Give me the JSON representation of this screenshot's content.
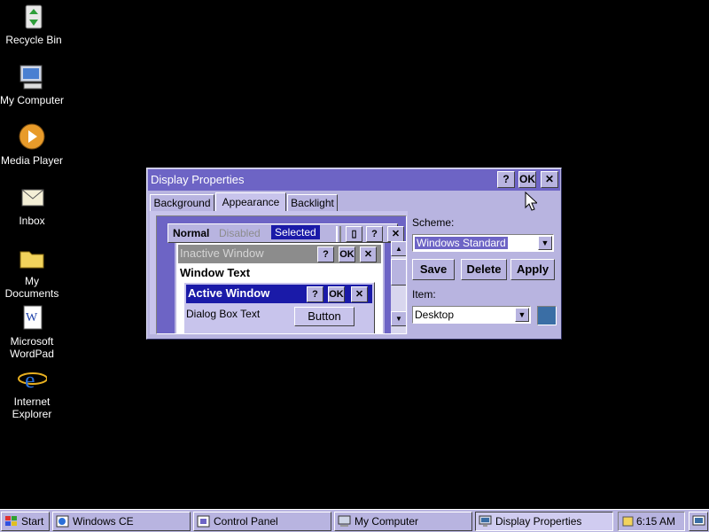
{
  "desktop": {
    "icons": [
      {
        "label": "Recycle Bin"
      },
      {
        "label": "My Computer"
      },
      {
        "label": "Media Player"
      },
      {
        "label": "Inbox"
      },
      {
        "label": "My Documents"
      },
      {
        "label": "Microsoft WordPad"
      },
      {
        "label": "Internet Explorer"
      }
    ]
  },
  "dialog": {
    "title": "Display Properties",
    "title_buttons": {
      "help": "?",
      "ok": "OK",
      "close": "✕"
    },
    "tabs": [
      "Background",
      "Appearance",
      "Backlight"
    ],
    "active_tab": "Appearance",
    "preview": {
      "menu": {
        "normal": "Normal",
        "disabled": "Disabled",
        "selected": "Selected"
      },
      "menu_buttons": {
        "doc": "▯",
        "help": "?",
        "close": "✕"
      },
      "inactive_title": "Inactive Window",
      "window_text": "Window Text",
      "active_title": "Active Window",
      "dialog_text": "Dialog Box Text",
      "button_label": "Button",
      "win_buttons": {
        "help": "?",
        "ok": "OK",
        "close": "✕"
      }
    },
    "scheme": {
      "label": "Scheme:",
      "value": "Windows Standard"
    },
    "buttons": {
      "save": "Save",
      "delete": "Delete",
      "apply": "Apply"
    },
    "item": {
      "label": "Item:",
      "value": "Desktop",
      "color": "#3a6ea5"
    }
  },
  "taskbar": {
    "start": "Start",
    "tasks": [
      "Windows CE",
      "Control Panel",
      "My Computer",
      "Display Properties"
    ],
    "active_task": "Display Properties",
    "clock": "6:15 AM"
  },
  "colors": {
    "titlebar": "#6d64c5",
    "face": "#b8b4e0",
    "active_title": "#1a1aa8",
    "inactive_title": "#8c8c8c"
  }
}
